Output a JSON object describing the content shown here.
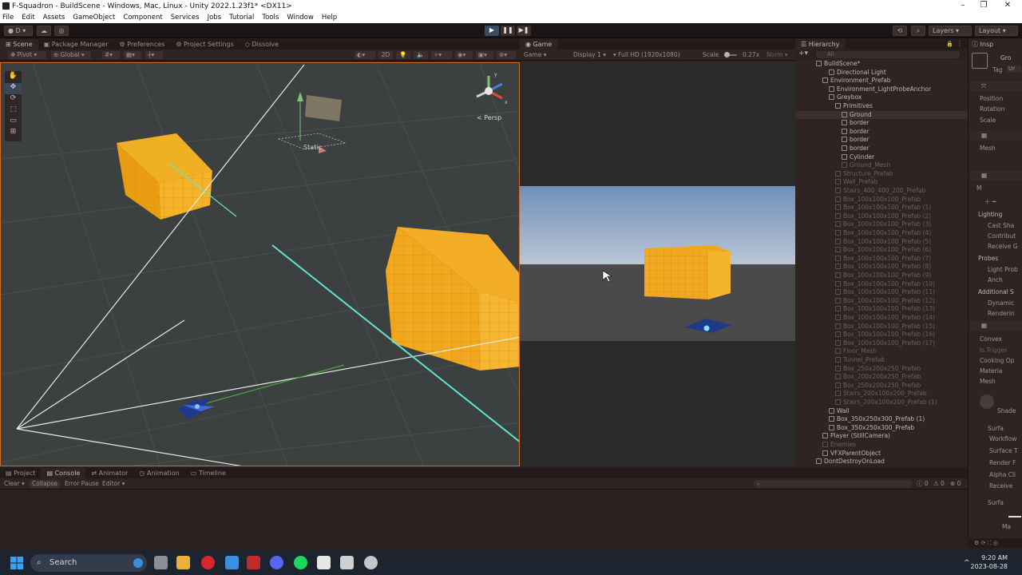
{
  "window": {
    "title": "F-Squadron - BuildScene - Windows, Mac, Linux - Unity 2022.1.23f1* <DX11>"
  },
  "menu": [
    "File",
    "Edit",
    "Assets",
    "GameObject",
    "Component",
    "Services",
    "Jobs",
    "Tutorial",
    "Tools",
    "Window",
    "Help"
  ],
  "toolbar": {
    "account": "D",
    "layers": "Layers",
    "layout": "Layout"
  },
  "play": {
    "play": "▶",
    "pause": "❚❚",
    "step": "▶❚"
  },
  "scene_tabs": [
    "Scene",
    "Package Manager",
    "Preferences",
    "Project Settings",
    "Dissolve"
  ],
  "scene_bar": {
    "pivot": "Pivot",
    "global": "Global",
    "mode2d": "2D",
    "persp": "< Persp",
    "static": "Static"
  },
  "game_tab": "Game",
  "game_bar": {
    "view": "Game",
    "display": "Display 1",
    "resolution": "Full HD (1920x1080)",
    "scale_label": "Scale",
    "scale_value": "0.27x",
    "maximize": "Norm"
  },
  "hierarchy": {
    "title": "Hierarchy",
    "search": "All",
    "rows": [
      {
        "t": "BuildScene*",
        "d": 0,
        "dim": false
      },
      {
        "t": "Directional Light",
        "d": 2,
        "dim": false
      },
      {
        "t": "Environment_Prefab",
        "d": 1,
        "dim": false
      },
      {
        "t": "Environment_LightProbeAnchor",
        "d": 2,
        "dim": false
      },
      {
        "t": "Greybox",
        "d": 2,
        "dim": false
      },
      {
        "t": "Primitives",
        "d": 3,
        "dim": false
      },
      {
        "t": "Ground",
        "d": 4,
        "dim": false,
        "sel": true
      },
      {
        "t": "border",
        "d": 4,
        "dim": false
      },
      {
        "t": "border",
        "d": 4,
        "dim": false
      },
      {
        "t": "border",
        "d": 4,
        "dim": false
      },
      {
        "t": "border",
        "d": 4,
        "dim": false
      },
      {
        "t": "Cylinder",
        "d": 4,
        "dim": false
      },
      {
        "t": "Ground_Mesh",
        "d": 4,
        "dim": true
      },
      {
        "t": "Structure_Prefab",
        "d": 3,
        "dim": true
      },
      {
        "t": "Wall_Prefab",
        "d": 3,
        "dim": true
      },
      {
        "t": "Stairs_400_400_200_Prefab",
        "d": 3,
        "dim": true
      },
      {
        "t": "Box_100x100x100_Prefab",
        "d": 3,
        "dim": true
      },
      {
        "t": "Box_100x100x100_Prefab (1)",
        "d": 3,
        "dim": true
      },
      {
        "t": "Box_100x100x100_Prefab (2)",
        "d": 3,
        "dim": true
      },
      {
        "t": "Box_100x100x100_Prefab (3)",
        "d": 3,
        "dim": true
      },
      {
        "t": "Box_100x100x100_Prefab (4)",
        "d": 3,
        "dim": true
      },
      {
        "t": "Box_100x100x100_Prefab (5)",
        "d": 3,
        "dim": true
      },
      {
        "t": "Box_100x100x100_Prefab (6)",
        "d": 3,
        "dim": true
      },
      {
        "t": "Box_100x100x100_Prefab (7)",
        "d": 3,
        "dim": true
      },
      {
        "t": "Box_100x100x100_Prefab (8)",
        "d": 3,
        "dim": true
      },
      {
        "t": "Box_100x100x100_Prefab (9)",
        "d": 3,
        "dim": true
      },
      {
        "t": "Box_100x100x100_Prefab (10)",
        "d": 3,
        "dim": true
      },
      {
        "t": "Box_100x100x100_Prefab (11)",
        "d": 3,
        "dim": true
      },
      {
        "t": "Box_100x100x100_Prefab (12)",
        "d": 3,
        "dim": true
      },
      {
        "t": "Box_100x100x100_Prefab (13)",
        "d": 3,
        "dim": true
      },
      {
        "t": "Box_100x100x100_Prefab (14)",
        "d": 3,
        "dim": true
      },
      {
        "t": "Box_100x100x100_Prefab (15)",
        "d": 3,
        "dim": true
      },
      {
        "t": "Box_100x100x100_Prefab (16)",
        "d": 3,
        "dim": true
      },
      {
        "t": "Box_100x100x100_Prefab (17)",
        "d": 3,
        "dim": true
      },
      {
        "t": "Floor_Mesh",
        "d": 3,
        "dim": true
      },
      {
        "t": "Tunnel_Prefab",
        "d": 3,
        "dim": true
      },
      {
        "t": "Box_250x200x250_Prefab",
        "d": 3,
        "dim": true
      },
      {
        "t": "Box_200x200x250_Prefab",
        "d": 3,
        "dim": true
      },
      {
        "t": "Box_250x200x250_Prefab",
        "d": 3,
        "dim": true
      },
      {
        "t": "Stairs_200x100x200_Prefab",
        "d": 3,
        "dim": true
      },
      {
        "t": "Stairs_200x100x200_Prefab (1)",
        "d": 3,
        "dim": true
      },
      {
        "t": "Wall",
        "d": 2,
        "dim": false
      },
      {
        "t": "Box_350x250x300_Prefab (1)",
        "d": 2,
        "dim": false
      },
      {
        "t": "Box_350x250x300_Prefab",
        "d": 2,
        "dim": false
      },
      {
        "t": "Player (StillCamera)",
        "d": 1,
        "dim": false
      },
      {
        "t": "Enemies",
        "d": 1,
        "dim": true
      },
      {
        "t": "VFXParentObject",
        "d": 1,
        "dim": false
      },
      {
        "t": "DontDestroyOnLoad",
        "d": 0,
        "dim": false
      }
    ]
  },
  "inspector": {
    "tab": "Insp",
    "name": "Gro",
    "tag_label": "Tag",
    "tag_value": "Ur",
    "transform": [
      "Position",
      "Rotation",
      "Scale"
    ],
    "mesh": "Mesh",
    "material": "M",
    "sections": [
      {
        "head": "Lighting",
        "items": [
          "Cast Sha",
          "Contribut",
          "Receive G"
        ]
      },
      {
        "head": "Probes",
        "items": [
          "Light Prob",
          "Anch"
        ]
      },
      {
        "head": "Additional S",
        "items": [
          "Dynamic",
          "Renderin"
        ]
      }
    ],
    "collider": [
      "Convex",
      "Is Trigger",
      "Cooking Op",
      "Materia",
      "Mesh"
    ],
    "shader": "Shade",
    "surface": [
      "Surfa",
      "Workflow",
      "Surface T",
      "Render F",
      "Alpha Cli",
      "Receive"
    ],
    "surface2": "Surfa",
    "surface2_item": "Ma"
  },
  "bottom_tabs": [
    "Project",
    "Console",
    "Animator",
    "Animation",
    "Timeline"
  ],
  "console_bar": {
    "clear": "Clear",
    "collapse": "Collapse",
    "error_pause": "Error Pause",
    "editor": "Editor",
    "counts": [
      "0",
      "0",
      "0"
    ]
  },
  "taskbar": {
    "search": "Search",
    "time": "9:20 AM",
    "date": "2023-08-28"
  }
}
